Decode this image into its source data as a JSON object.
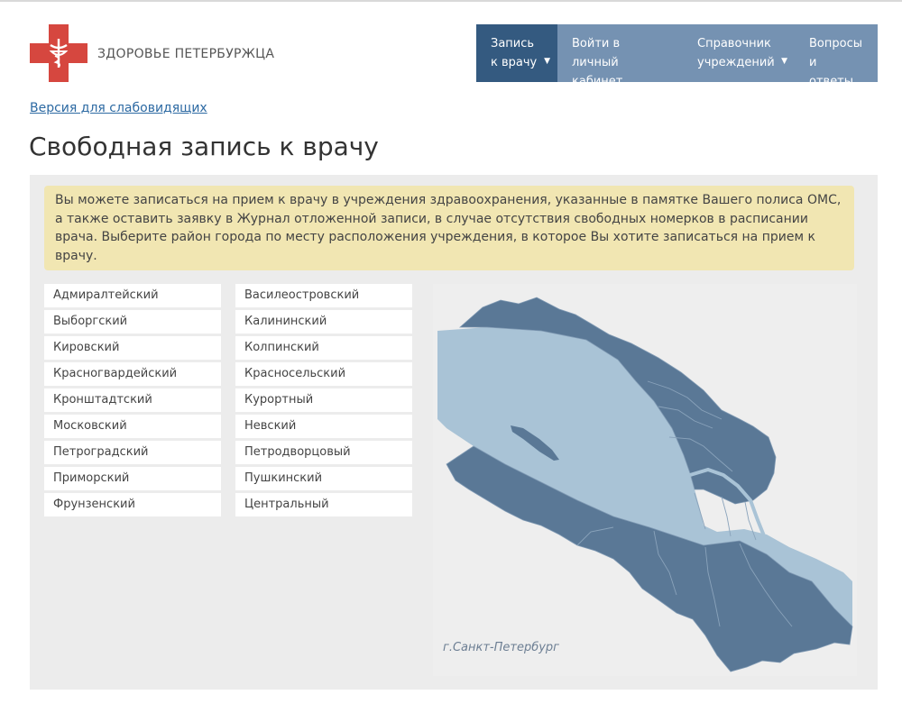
{
  "header": {
    "brand": "ЗДОРОВЬЕ ПЕТЕРБУРЖЦА",
    "brand_color": "#d6473f"
  },
  "nav": [
    {
      "line1": "Запись",
      "line2": "к врачу",
      "has_dropdown": true,
      "active": true
    },
    {
      "line1": "Войти в",
      "line2": "личный кабинет",
      "has_dropdown": false,
      "active": false
    },
    {
      "line1": "Справочник",
      "line2": "учреждений",
      "has_dropdown": true,
      "active": false
    },
    {
      "line1": "Вопросы",
      "line2": "и ответы",
      "has_dropdown": false,
      "active": false
    }
  ],
  "accessibility_link": "Версия для слабовидящих",
  "page_title": "Свободная запись к врачу",
  "notice": "Вы можете записаться на прием к врачу в учреждения здравоохранения, указанные в памятке Вашего полиса ОМС, а также оставить заявку в Журнал отложенной записи, в случае отсутствия свободных номерков в расписании врача. Выберите район города по месту расположения учреждения, в которое Вы хотите записаться на прием к врачу.",
  "districts": {
    "col1": [
      "Адмиралтейский",
      "Выборгский",
      "Кировский",
      "Красногвардейский",
      "Кронштадтский",
      "Московский",
      "Петроградский",
      "Приморский",
      "Фрунзенский"
    ],
    "col2": [
      "Василеостровский",
      "Калининский",
      "Колпинский",
      "Красносельский",
      "Курортный",
      "Невский",
      "Петродворцовый",
      "Пушкинский",
      "Центральный"
    ]
  },
  "map": {
    "label": "г.Санкт-Петербург",
    "water_color": "#a9c3d6",
    "land_color": "#5a7896"
  }
}
